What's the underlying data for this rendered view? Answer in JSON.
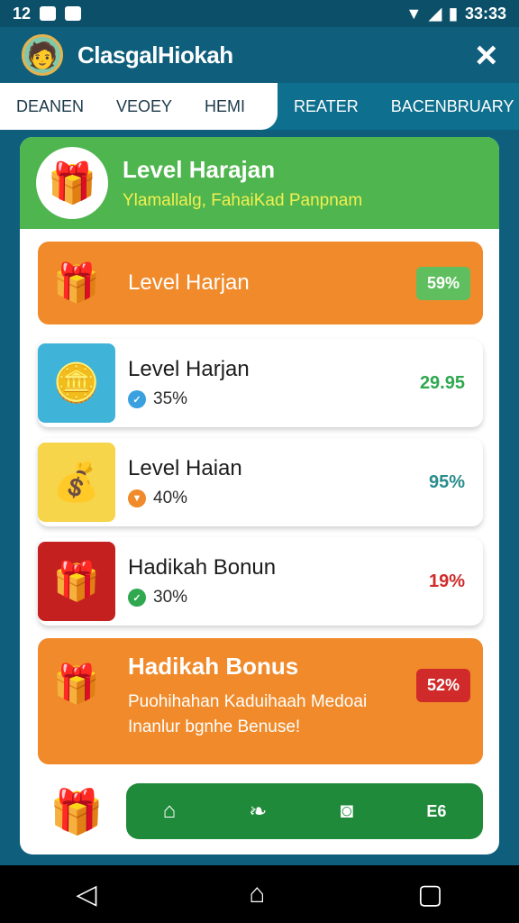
{
  "status": {
    "time_left": "12",
    "time_right": "33:33",
    "icons": [
      "notification-icon",
      "camera-icon",
      "wifi-icon",
      "signal-icon",
      "battery-icon"
    ]
  },
  "header": {
    "title": "ClasgalHiokah",
    "close_icon": "×"
  },
  "tabs": [
    "DEANEN",
    "VEOEY",
    "HEMI",
    "REATER",
    "BACENBRUARY"
  ],
  "panel": {
    "title": "Level Harajan",
    "subtitle": "Ylamallalg, FahaiKad Panpnam"
  },
  "cards": [
    {
      "title": "Level Harjan",
      "value": "59%",
      "value_color": "#2fa84f"
    },
    {
      "title": "Level Harjan",
      "sub": "35%",
      "value": "29.95",
      "value_color": "#2fa84f",
      "dot_color": "#3aa0e0"
    },
    {
      "title": "Level Haian",
      "sub": "40%",
      "value": "95%",
      "value_color": "#2a8c8c",
      "dot_color": "#f08a2a"
    },
    {
      "title": "Hadikah Bonun",
      "sub": "30%",
      "value": "19%",
      "value_color": "#d02a2a",
      "dot_color": "#2fa84f"
    }
  ],
  "bonus": {
    "title": "Hadikah Bonus",
    "desc_line1": "Puohihahan Kaduihaah Medoai",
    "desc_line2": "Inanlur bgnhe Benuse!",
    "value": "52%"
  },
  "bottom_nav": {
    "items": [
      "home-icon",
      "leaf-icon",
      "camera-icon"
    ],
    "last_label": "E6"
  },
  "colors": {
    "accent_green": "#4fb54f",
    "accent_orange": "#f08a2a",
    "accent_teal": "#0f5f7c",
    "nav_green": "#1f8a3a"
  }
}
